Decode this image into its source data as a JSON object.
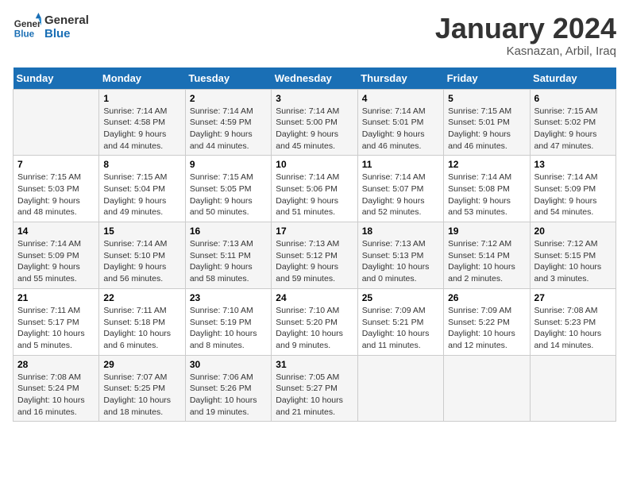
{
  "logo": {
    "line1": "General",
    "line2": "Blue"
  },
  "title": "January 2024",
  "subtitle": "Kasnazan, Arbil, Iraq",
  "weekdays": [
    "Sunday",
    "Monday",
    "Tuesday",
    "Wednesday",
    "Thursday",
    "Friday",
    "Saturday"
  ],
  "weeks": [
    [
      {
        "day": "",
        "info": ""
      },
      {
        "day": "1",
        "info": "Sunrise: 7:14 AM\nSunset: 4:58 PM\nDaylight: 9 hours\nand 44 minutes."
      },
      {
        "day": "2",
        "info": "Sunrise: 7:14 AM\nSunset: 4:59 PM\nDaylight: 9 hours\nand 44 minutes."
      },
      {
        "day": "3",
        "info": "Sunrise: 7:14 AM\nSunset: 5:00 PM\nDaylight: 9 hours\nand 45 minutes."
      },
      {
        "day": "4",
        "info": "Sunrise: 7:14 AM\nSunset: 5:01 PM\nDaylight: 9 hours\nand 46 minutes."
      },
      {
        "day": "5",
        "info": "Sunrise: 7:15 AM\nSunset: 5:01 PM\nDaylight: 9 hours\nand 46 minutes."
      },
      {
        "day": "6",
        "info": "Sunrise: 7:15 AM\nSunset: 5:02 PM\nDaylight: 9 hours\nand 47 minutes."
      }
    ],
    [
      {
        "day": "7",
        "info": "Sunrise: 7:15 AM\nSunset: 5:03 PM\nDaylight: 9 hours\nand 48 minutes."
      },
      {
        "day": "8",
        "info": "Sunrise: 7:15 AM\nSunset: 5:04 PM\nDaylight: 9 hours\nand 49 minutes."
      },
      {
        "day": "9",
        "info": "Sunrise: 7:15 AM\nSunset: 5:05 PM\nDaylight: 9 hours\nand 50 minutes."
      },
      {
        "day": "10",
        "info": "Sunrise: 7:14 AM\nSunset: 5:06 PM\nDaylight: 9 hours\nand 51 minutes."
      },
      {
        "day": "11",
        "info": "Sunrise: 7:14 AM\nSunset: 5:07 PM\nDaylight: 9 hours\nand 52 minutes."
      },
      {
        "day": "12",
        "info": "Sunrise: 7:14 AM\nSunset: 5:08 PM\nDaylight: 9 hours\nand 53 minutes."
      },
      {
        "day": "13",
        "info": "Sunrise: 7:14 AM\nSunset: 5:09 PM\nDaylight: 9 hours\nand 54 minutes."
      }
    ],
    [
      {
        "day": "14",
        "info": "Sunrise: 7:14 AM\nSunset: 5:09 PM\nDaylight: 9 hours\nand 55 minutes."
      },
      {
        "day": "15",
        "info": "Sunrise: 7:14 AM\nSunset: 5:10 PM\nDaylight: 9 hours\nand 56 minutes."
      },
      {
        "day": "16",
        "info": "Sunrise: 7:13 AM\nSunset: 5:11 PM\nDaylight: 9 hours\nand 58 minutes."
      },
      {
        "day": "17",
        "info": "Sunrise: 7:13 AM\nSunset: 5:12 PM\nDaylight: 9 hours\nand 59 minutes."
      },
      {
        "day": "18",
        "info": "Sunrise: 7:13 AM\nSunset: 5:13 PM\nDaylight: 10 hours\nand 0 minutes."
      },
      {
        "day": "19",
        "info": "Sunrise: 7:12 AM\nSunset: 5:14 PM\nDaylight: 10 hours\nand 2 minutes."
      },
      {
        "day": "20",
        "info": "Sunrise: 7:12 AM\nSunset: 5:15 PM\nDaylight: 10 hours\nand 3 minutes."
      }
    ],
    [
      {
        "day": "21",
        "info": "Sunrise: 7:11 AM\nSunset: 5:17 PM\nDaylight: 10 hours\nand 5 minutes."
      },
      {
        "day": "22",
        "info": "Sunrise: 7:11 AM\nSunset: 5:18 PM\nDaylight: 10 hours\nand 6 minutes."
      },
      {
        "day": "23",
        "info": "Sunrise: 7:10 AM\nSunset: 5:19 PM\nDaylight: 10 hours\nand 8 minutes."
      },
      {
        "day": "24",
        "info": "Sunrise: 7:10 AM\nSunset: 5:20 PM\nDaylight: 10 hours\nand 9 minutes."
      },
      {
        "day": "25",
        "info": "Sunrise: 7:09 AM\nSunset: 5:21 PM\nDaylight: 10 hours\nand 11 minutes."
      },
      {
        "day": "26",
        "info": "Sunrise: 7:09 AM\nSunset: 5:22 PM\nDaylight: 10 hours\nand 12 minutes."
      },
      {
        "day": "27",
        "info": "Sunrise: 7:08 AM\nSunset: 5:23 PM\nDaylight: 10 hours\nand 14 minutes."
      }
    ],
    [
      {
        "day": "28",
        "info": "Sunrise: 7:08 AM\nSunset: 5:24 PM\nDaylight: 10 hours\nand 16 minutes."
      },
      {
        "day": "29",
        "info": "Sunrise: 7:07 AM\nSunset: 5:25 PM\nDaylight: 10 hours\nand 18 minutes."
      },
      {
        "day": "30",
        "info": "Sunrise: 7:06 AM\nSunset: 5:26 PM\nDaylight: 10 hours\nand 19 minutes."
      },
      {
        "day": "31",
        "info": "Sunrise: 7:05 AM\nSunset: 5:27 PM\nDaylight: 10 hours\nand 21 minutes."
      },
      {
        "day": "",
        "info": ""
      },
      {
        "day": "",
        "info": ""
      },
      {
        "day": "",
        "info": ""
      }
    ]
  ]
}
